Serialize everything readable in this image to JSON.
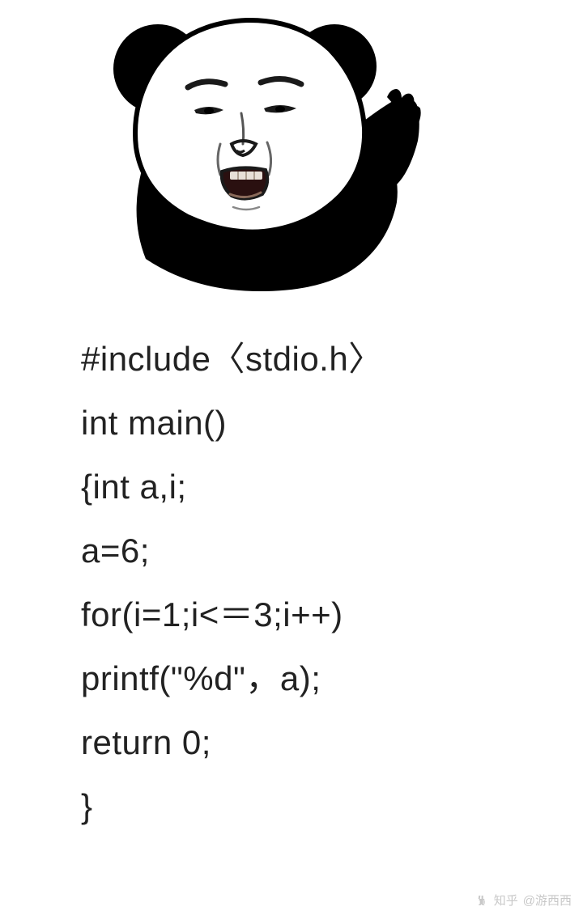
{
  "meme": {
    "description": "panda-head-meme-confused-gesture"
  },
  "code": {
    "lines": [
      "#include〈stdio.h〉",
      "int main()",
      "{int a,i;",
      "a=6;",
      "for(i=1;i<＝3;i++)",
      "printf(\"%d\"，a);",
      "return 0;",
      "}"
    ]
  },
  "watermark": {
    "platform": "知乎",
    "author": "@游西西"
  }
}
